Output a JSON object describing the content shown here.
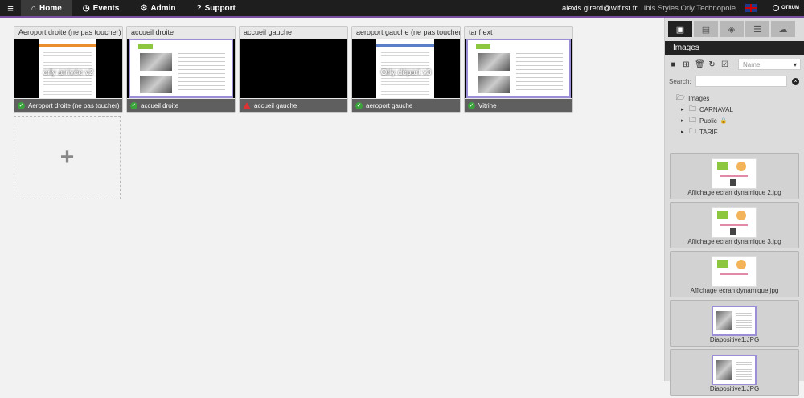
{
  "nav": {
    "menu_icon": "hamburger-icon",
    "items": [
      {
        "label": "Home",
        "icon": "home-icon",
        "active": true
      },
      {
        "label": "Events",
        "icon": "clock-icon"
      },
      {
        "label": "Admin",
        "icon": "gears-icon"
      },
      {
        "label": "Support",
        "icon": "question-icon"
      }
    ]
  },
  "header": {
    "user": "alexis.girerd@wifirst.fr",
    "site": "Ibis Styles Orly Technopole",
    "brand": "OTRUM",
    "accent_color": "#7b4fa0"
  },
  "screens": [
    {
      "title": "Aeroport droite (ne pas toucher)",
      "overlay": "orly arrivée v2",
      "status": "Aeroport droite (ne pas toucher)",
      "status_type": "ok"
    },
    {
      "title": "accueil droite",
      "overlay": "",
      "status": "accueil droite",
      "status_type": "ok"
    },
    {
      "title": "accueil gauche",
      "overlay": "",
      "status": "accueil gauche",
      "status_type": "warning"
    },
    {
      "title": "aeroport gauche (ne pas toucher)",
      "overlay": "Orly départ v3",
      "status": "aeroport gauche",
      "status_type": "ok"
    },
    {
      "title": "tarif ext",
      "overlay": "",
      "status": "Vitrine",
      "status_type": "ok"
    }
  ],
  "add_screen": {
    "symbol": "+"
  },
  "sidebar": {
    "tabs": [
      "image-icon",
      "film-icon",
      "cube-icon",
      "list-icon",
      "cloud-icon"
    ],
    "header": "Images",
    "sort_select": "Name",
    "search_label": "Search:",
    "tree": {
      "root": "Images",
      "children": [
        {
          "label": "CARNAVAL",
          "locked": false
        },
        {
          "label": "Public",
          "locked": true
        },
        {
          "label": "TARIF",
          "locked": false
        }
      ]
    },
    "thumbs": [
      {
        "label": "Affichage ecran dynamique 2.jpg"
      },
      {
        "label": "Affichage ecran dynamique 3.jpg"
      },
      {
        "label": "Affichage ecran dynamique.jpg"
      },
      {
        "label": "Diapositive1.JPG"
      },
      {
        "label": "Diapositive1.JPG"
      }
    ]
  }
}
